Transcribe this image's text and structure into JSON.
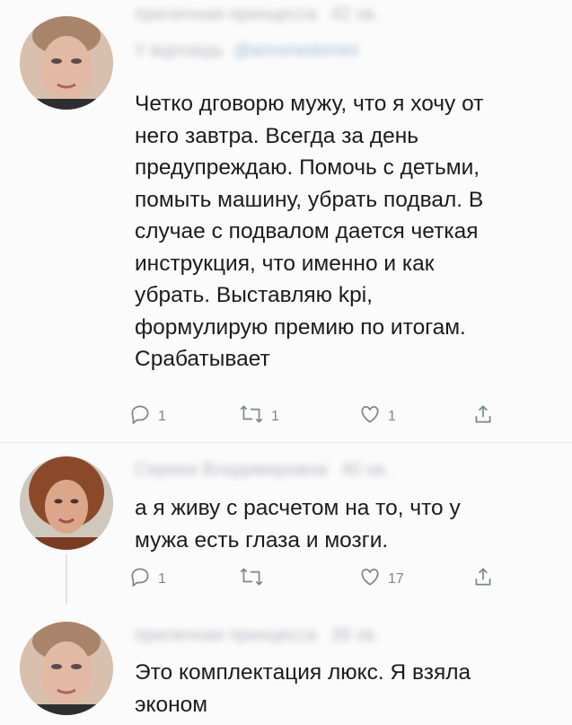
{
  "tweets": [
    {
      "author": "приличная принцесса",
      "time": "42 хв.",
      "reply_prefix": "У відповідь",
      "reply_to": "@annonedomini",
      "text": "Четко дговорю мужу, что я хочу от\nнего завтра. Всегда за день\nпредупреждаю. Помочь с детьми,\nпомыть машину, убрать подвал. В\nслучае с подвалом дается четкая\nинструкция, что именно и как\nубрать.  Выставляю kpi,\nформулирую премию по итогам.\nСрабатывает",
      "replies": "1",
      "retweets": "1",
      "likes": "1"
    },
    {
      "author": "Сереея Владимировна",
      "time": "40 хв.",
      "text": "а я живу с расчетом на то, что у\nмужа есть глаза и мозги.",
      "replies": "1",
      "retweets": "",
      "likes": "17"
    },
    {
      "author": "приличная принцесса",
      "time": "39 хв.",
      "text": "Это комплектация люкс. Я взяла\nэконом"
    }
  ],
  "colors": {
    "icon_gray": "#7b8790",
    "blurred_name": "#b9b9c2",
    "blurred_link": "#9dbad6"
  },
  "icons": [
    "reply-icon",
    "retweet-icon",
    "like-icon",
    "share-icon"
  ]
}
